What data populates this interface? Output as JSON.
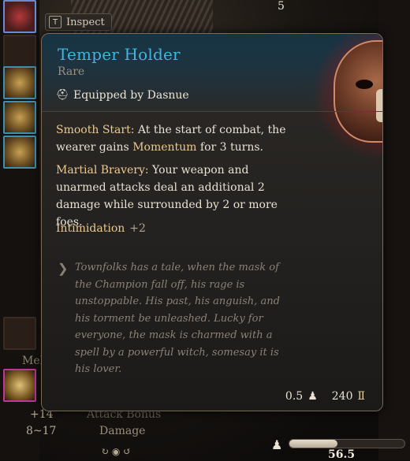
{
  "inspect": {
    "key": "T",
    "label": "Inspect"
  },
  "item": {
    "name": "Temper Holder",
    "rarity": "Rare",
    "equipped_by": "Equipped by Dasnue",
    "smooth_start": {
      "label": "Smooth Start:",
      "text_1": " At the start of combat, the wearer gains ",
      "keyword": "Momentum",
      "text_2": " for 3 turns."
    },
    "martial_bravery": {
      "label": "Martial Bravery:",
      "text": " Your weapon and unarmed attacks deal an additional 2 damage while surrounded by 2 or more foes."
    },
    "skill": {
      "name": "Intimidation",
      "value": "+2"
    },
    "lore": "Townfolks has a tale, when the mask of the Champion fall off, his rage is unstoppable. His past, his anguish, and his torment be unleashed. Lucky for everyone, the mask is charmed with a spell by a powerful witch, somesay it is his lover.",
    "weight": "0.5",
    "value": "240"
  },
  "background": {
    "top_count": "5",
    "attack_label": "+14",
    "attack_bonus_label": "Attack Bonus",
    "damage_range": "8~17",
    "damage_label": "Damage",
    "melee_label": "Mel",
    "carry_weight": "56.5",
    "carry_fraction": 0.42
  },
  "colors": {
    "title": "#3fb6e0",
    "keyword": "#ecc98e",
    "border": "#7b6a55"
  },
  "icons": {
    "equip": "helmet-icon",
    "lore": "quill-icon",
    "weight": "weight-icon",
    "gold": "gold-coin-icon"
  }
}
